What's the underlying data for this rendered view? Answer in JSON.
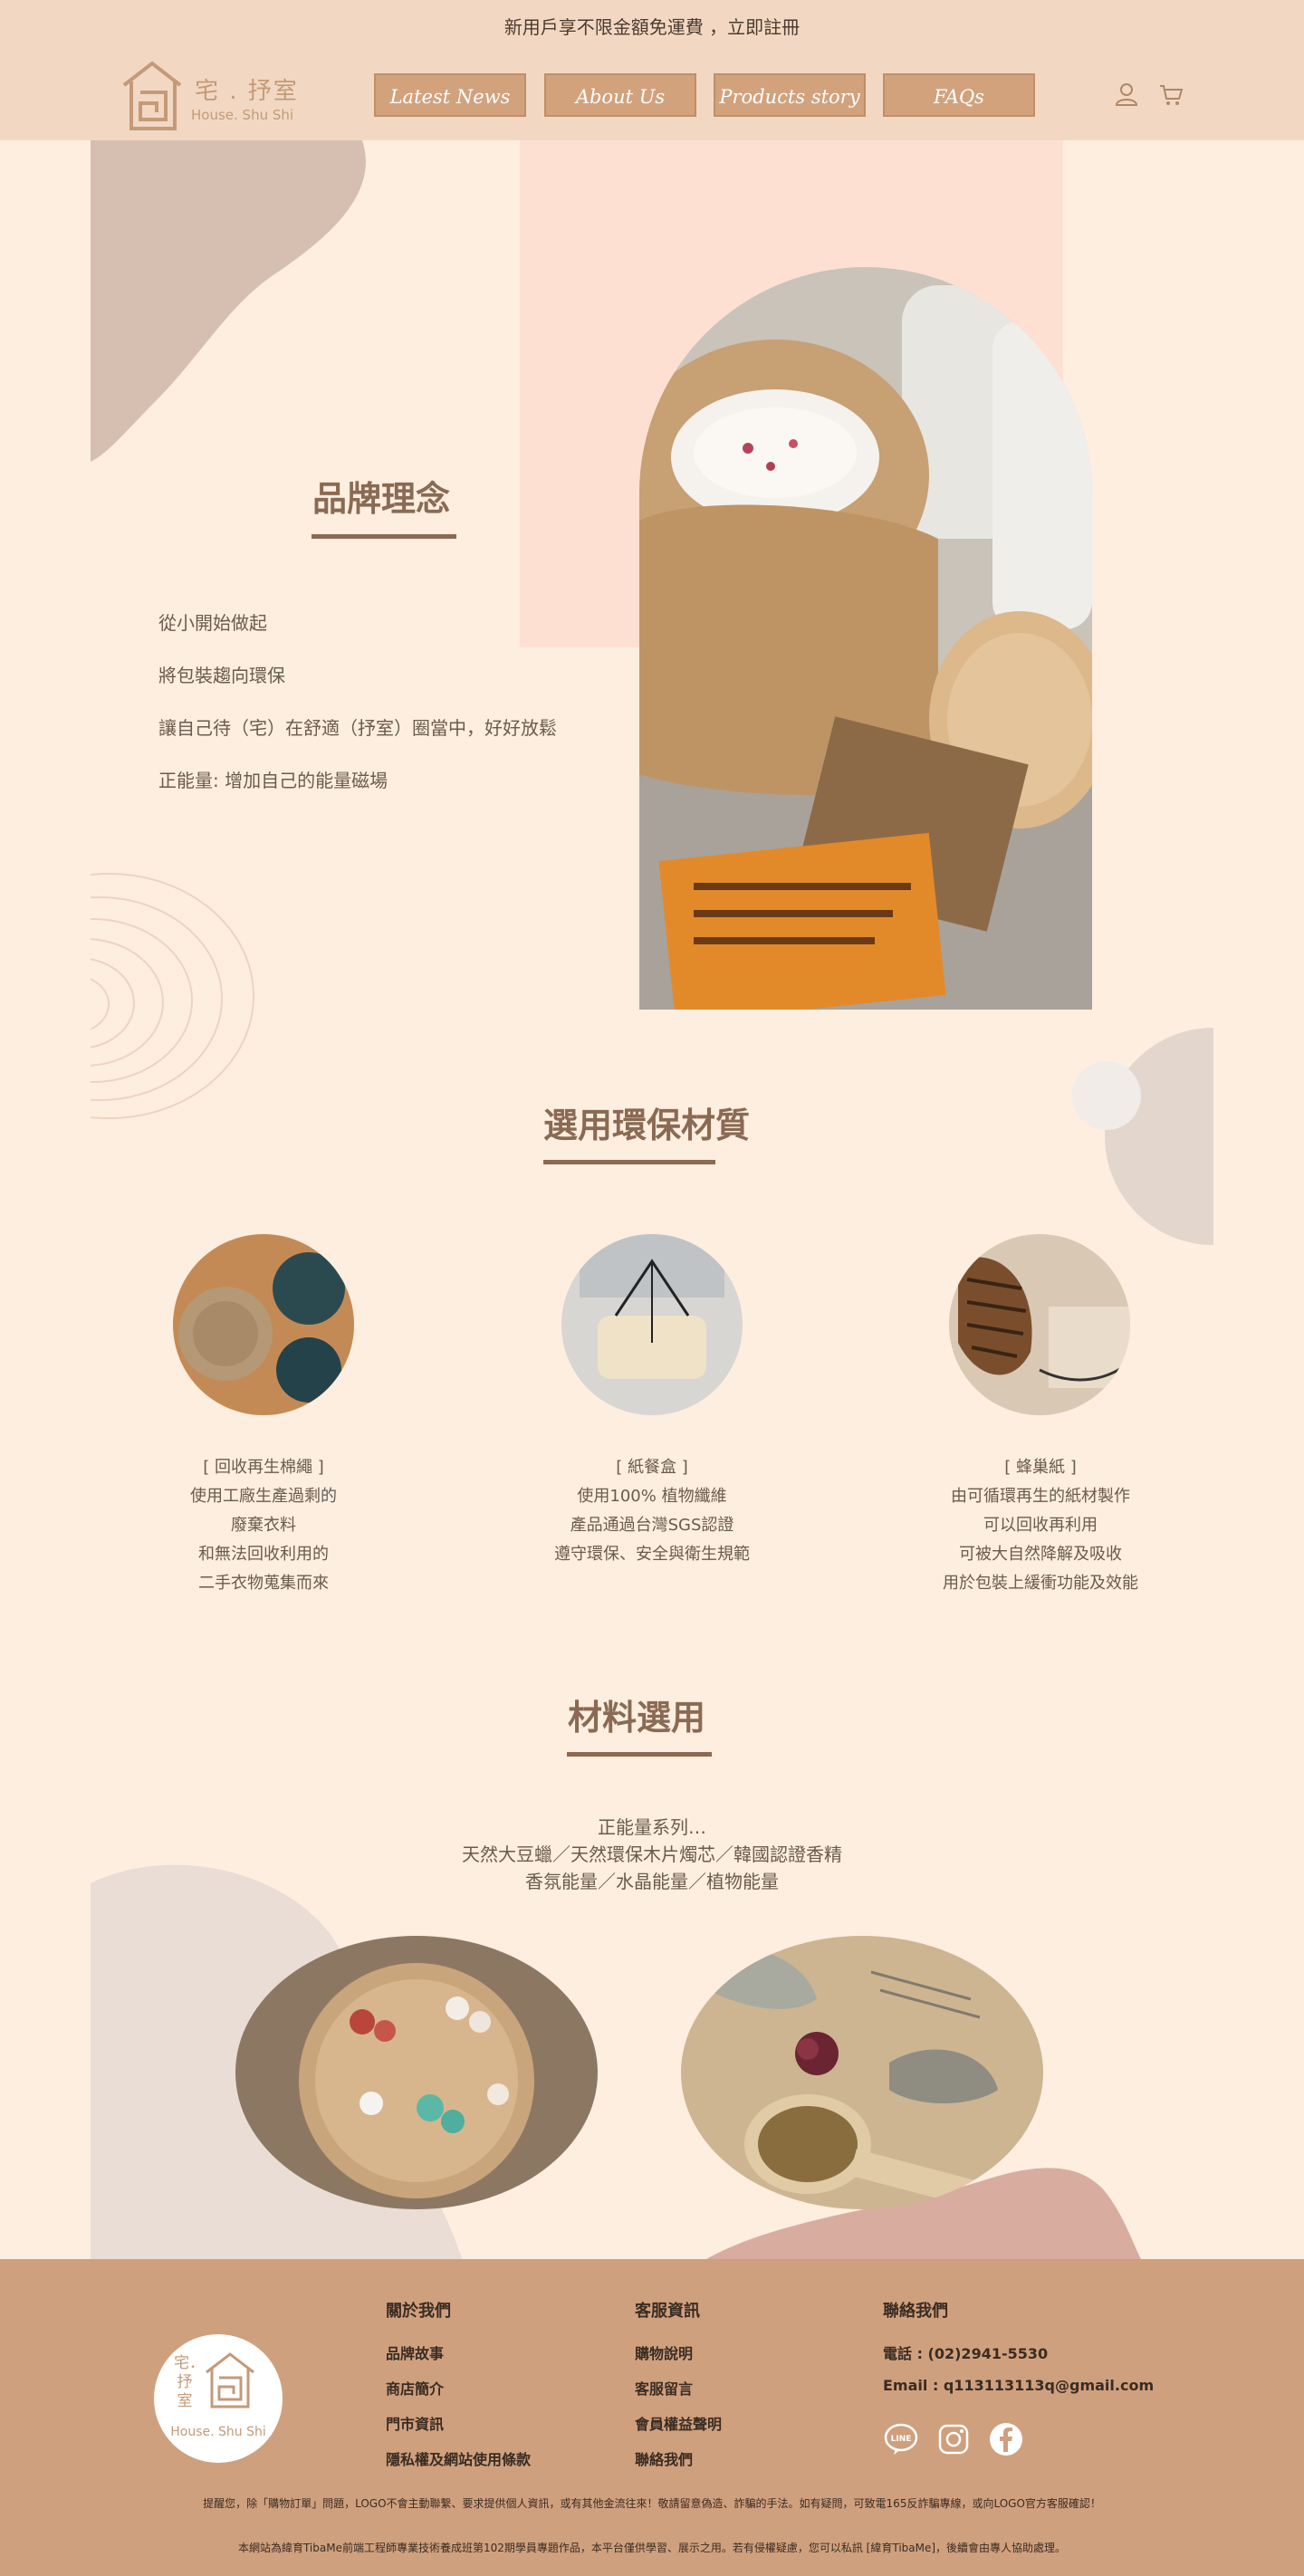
{
  "header": {
    "announcement": "新用戶享不限金額免運費 ，立即註冊",
    "logo_name": "宅 . 抒室",
    "logo_sub": "House. Shu Shi",
    "nav": [
      "Latest News",
      "About Us",
      "Products story",
      "FAQs"
    ],
    "icons": [
      "user-icon",
      "cart-icon"
    ]
  },
  "brand": {
    "title": "品牌理念",
    "items": [
      "從小開始做起",
      "將包裝趨向環保",
      "讓自己待（宅）在舒適（抒室）圈當中，好好放鬆",
      "正能量: 增加自己的能量磁場"
    ]
  },
  "materials": {
    "title": "選用環保材質",
    "items": [
      {
        "name": "[ 回收再生棉繩 ]",
        "lines": [
          "使用工廠生產過剩的",
          "廢棄衣料",
          "和無法回收利用的",
          "二手衣物蒐集而來"
        ]
      },
      {
        "name": "[ 紙餐盒 ]",
        "lines": [
          "使用100% 植物纖維",
          "產品通過台灣SGS認證",
          "遵守環保、安全與衛生規範"
        ]
      },
      {
        "name": "[ 蜂巢紙 ]",
        "lines": [
          "由可循環再生的紙材製作",
          "可以回收再利用",
          "可被大自然降解及吸收",
          "用於包裝上緩衝功能及效能"
        ]
      }
    ]
  },
  "ingredients": {
    "title": "材料選用",
    "lines": [
      "正能量系列…",
      "天然大豆蠟／天然環保木片燭芯／韓國認證香精",
      "香氛能量／水晶能量／植物能量"
    ]
  },
  "footer": {
    "logo_name": "宅．抒室",
    "logo_sub": "House. Shu Shi",
    "about": {
      "title": "關於我們",
      "links": [
        "品牌故事",
        "商店簡介",
        "門市資訊",
        "隱私權及網站使用條款"
      ]
    },
    "service": {
      "title": "客服資訊",
      "links": [
        "購物說明",
        "客服留言",
        "會員權益聲明",
        "聯絡我們"
      ]
    },
    "contact": {
      "title": "聯絡我們",
      "phone": "電話 : (02)2941-5530",
      "email": "Email : q113113113q@gmail.com"
    },
    "social": [
      "line-icon",
      "instagram-icon",
      "facebook-icon"
    ],
    "notice": "提醒您，除「購物訂單」問題，LOGO不會主動聯繫、要求提供個人資訊，或有其他金流往來！敬請留意偽造、詐騙的手法。如有疑問，可致電165反詐騙專線，或向LOGO官方客服確認！",
    "disclaimer": "本網站為緯育TibaMe前端工程師專業技術養成班第102期學員專題作品，本平台僅供學習、展示之用。若有侵權疑慮，您可以私訊 [緯育TibaMe]，後續會由專人協助處理。"
  },
  "colors": {
    "header_bg": "#f2d8c2",
    "page_bg": "#fdeee0",
    "nav_bg": "#d2a27d",
    "accent": "#8a6a53",
    "footer_bg": "#cfa07e"
  }
}
